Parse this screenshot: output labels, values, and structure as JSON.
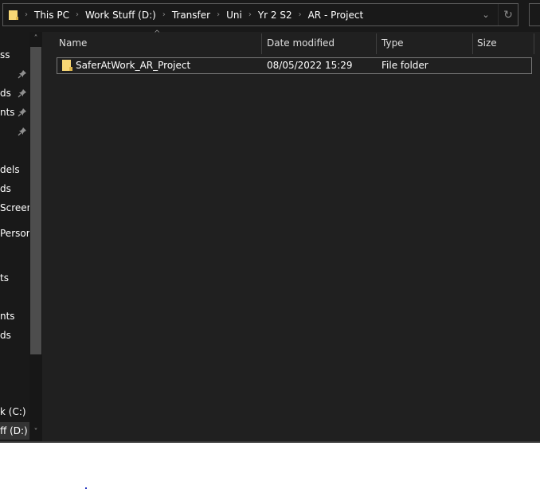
{
  "address_bar": {
    "breadcrumbs": [
      "This PC",
      "Work Stuff (D:)",
      "Transfer",
      "Uni",
      "Yr 2 S2",
      "AR - Project"
    ],
    "separator_icon": "chevron-right-icon",
    "dropdown_icon": "chevron-down-icon",
    "refresh_icon": "refresh-icon"
  },
  "nav_pane": {
    "items": [
      {
        "label": "ss",
        "pinned": false
      },
      {
        "label": "",
        "pinned": true
      },
      {
        "label": "ds",
        "pinned": true
      },
      {
        "label": "nts",
        "pinned": true
      },
      {
        "label": "",
        "pinned": true
      },
      {
        "label": "dels",
        "pinned": false
      },
      {
        "label": "ds",
        "pinned": false
      },
      {
        "label": "Screens",
        "pinned": false
      },
      {
        "label": " Persor",
        "pinned": false
      },
      {
        "label": "ts",
        "pinned": false
      },
      {
        "label": "nts",
        "pinned": false
      },
      {
        "label": "ds",
        "pinned": false
      },
      {
        "label": "k (C:)",
        "pinned": false
      },
      {
        "label": "ff (D:)",
        "pinned": false,
        "selected": true
      }
    ]
  },
  "file_list": {
    "columns": [
      "Name",
      "Date modified",
      "Type",
      "Size"
    ],
    "sort_indicator": "^",
    "rows": [
      {
        "name": "SaferAtWork_AR_Project",
        "date_modified": "08/05/2022 15:29",
        "type": "File folder",
        "size": ""
      }
    ]
  },
  "colors": {
    "folder": "#f8d775",
    "background": "#191919",
    "content_background": "#202020"
  }
}
